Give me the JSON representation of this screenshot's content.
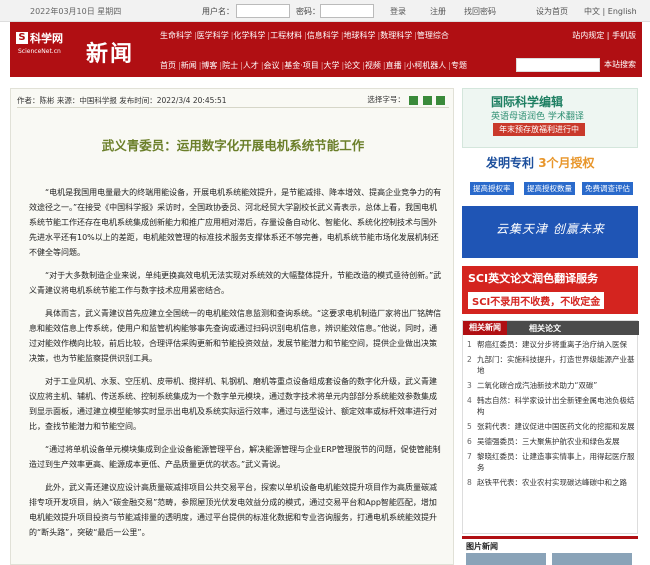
{
  "topbar": {
    "date": "2022年03月10日 星期四",
    "username_label": "用户名：",
    "password_label": "密码：",
    "login": "登录",
    "register": "注册",
    "forgot": "找回密码",
    "set_home": "设为首页",
    "lang": "中文 | English"
  },
  "header": {
    "logo_icon": "S",
    "logo_name": "科学网",
    "logo_domain": "ScienceNet.cn",
    "section": "新闻",
    "nav1": [
      "生命科学",
      "医学科学",
      "化学科学",
      "工程材料",
      "信息科学",
      "地球科学",
      "数理科学",
      "管理综合"
    ],
    "nav2": [
      "首页",
      "新闻",
      "博客",
      "院士",
      "人才",
      "会议",
      "基金·项目",
      "大学",
      "论文",
      "视频",
      "直播",
      "小柯机器人",
      "专题"
    ],
    "right_links": "站内规定 | 手机版",
    "search_btn": "本站搜索"
  },
  "article": {
    "meta": "作者：陈彬  来源：中国科学报  发布时间：2022/3/4 20:45:51",
    "font_label": "选择字号：",
    "title": "武义青委员：运用数字化开展电机系统节能工作",
    "paragraphs": [
      "“电机是我国用电量最大的终端用能设备，开展电机系统能效提升，是节能减排、降本增效、提高企业竞争力的有效途径之一。”在接受《中国科学报》采访时，全国政协委员、河北经贸大学副校长武义青表示，总体上看，我国电机系统节能工作还存在电机系统集成创新能力和推广应用相对滞后，存量设备自动化、智能化、系统化控制技术与国外先进水平还有10%以上的差距，电机能效管理的标准技术服务支撑体系还不够完善，电机系统节能市场化发展机制还不健全等问题。",
      "“对于大多数制造企业来说，单纯更换高效电机无法实现对系统效的大幅整体提升，节能改造的模式亟待创新。”武义青建议将电机系统节能工作与数字技术应用紧密结合。",
      "具体而言，武义青建议首先应建立全国统一的电机能效信息监测和查询系统。“这要求电机制造厂家将出厂铭牌信息和能效信息上传系统，使用户和监管机构能够事先查询或通过扫码识别电机信息，辨识能效信息。”他说，同时，通过对能效作横向比较，前后比较，合理评估采购更新和节能投资效益，发展节能潜力和节能空间，提供企业做出决策决策，也为节能监察提供识别工具。",
      "对于工业风机、水泵、空压机、皮带机、搅拌机、轧钢机、磨机等重点设备组成套设备的数字化升级，武义青建议应将主机、辅机、传送系统、控制系统集成为一个数字单元模块，通过数字技术将单元内部部分系统能效参数集成到显示面板，通过建立模型能够实时显示出电机及系统实际运行效率，通过与选型设计、额定效率或标杆效率进行对比，查找节能潜力和节能空间。",
      "“通过将单机设备单元模块集成到企业设备能源管理平台，解决能源管理与企业ERP管理脱节的问题，促使管能制造过到生产效率更高、能源成本更低、产品质量更优的状态。”武义青说。",
      "此外，武义青还建议应设计高质量碳减排项目公共交易平台，探索以单机设备电机能效提升项目作为高质量碳减排专项开发项目，纳入“碳金融交易”范畴，参照屋顶光伏发电效益分成的模式，通过交易平台和App智能匹配，增加电机能效提升项目投资与节能减排量的透明度，通过平台提供的标准化数据和专业咨询服务，打通电机系统能效提升的“断头路”，突破“最后一公里”。"
    ]
  },
  "sidebar": {
    "ad_editing": {
      "title": "国际科学编辑",
      "subtitle": "英语母语润色 学术翻译",
      "badge": "年末预存放福利进行中"
    },
    "ad_patent": {
      "title_a": "发明专利 ",
      "title_b": "3个月授权",
      "tags": [
        "提高授权率",
        "提高授权数量",
        "免费调查评估"
      ]
    },
    "ad_banner": {
      "title": "云集天津 创赢未来"
    },
    "ad_sci": {
      "title": "SCI英文论文润色翻译服务",
      "subtitle": "SCI不录用不收费，不收定金"
    },
    "related": {
      "tab_news": "相关新闻",
      "tab_papers": "相关论文",
      "items": [
        "帮癌红委员：建议分步将重离子治疗纳入医保",
        "九部门：实施科技提升，打造世界级能源产业基地",
        "二氧化碳合成汽油新技术助力“双碳”",
        "韩志自然：科学家设计出全新锂金属电池负极结构",
        "张莉代表：建议促进中国医药文化的挖掘和发展",
        "吴德强委员：三大聚焦护航农业和绿色发展",
        "黎晓红委员：让建造事实情事上，用得起医疗服务",
        "赵铁平代表：农业农村实现碳达峰碳中和之路"
      ]
    },
    "image_news": "图片新闻"
  },
  "colors": {
    "brand_red": "#b00f13",
    "title_green": "#6b7f2a"
  }
}
